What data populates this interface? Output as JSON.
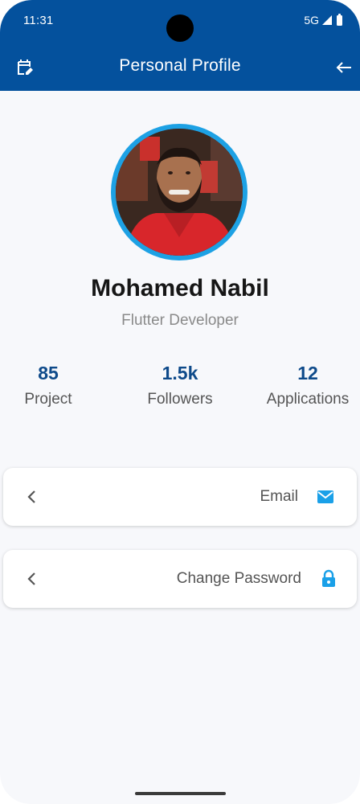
{
  "status_bar": {
    "time": "11:31",
    "network": "5G"
  },
  "app_bar": {
    "title": "Personal Profile",
    "left_icon": "edit-calendar-icon",
    "right_icon": "arrow-back-icon"
  },
  "profile": {
    "name": "Mohamed Nabil",
    "role": "Flutter Developer"
  },
  "stats": [
    {
      "value": "85",
      "label": "Project"
    },
    {
      "value": "1.5k",
      "label": "Followers"
    },
    {
      "value": "12",
      "label": "Applications"
    }
  ],
  "menu": [
    {
      "label": "Email",
      "icon": "mail-icon"
    },
    {
      "label": "Change Password",
      "icon": "lock-icon"
    }
  ],
  "colors": {
    "app_bar": "#04519d",
    "accent": "#1da1e4",
    "stat_value": "#0e4a8a",
    "background": "#f7f8fb"
  }
}
